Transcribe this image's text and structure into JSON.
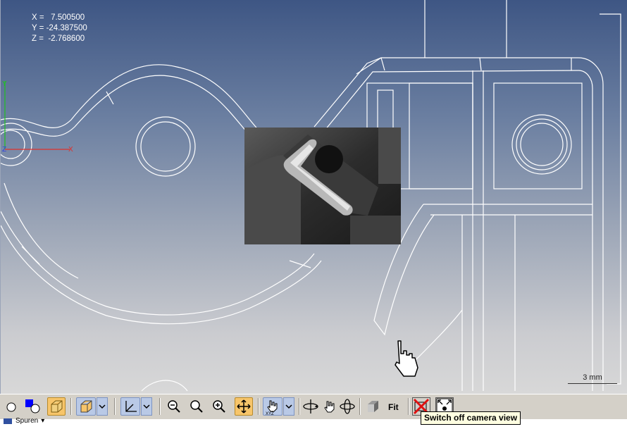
{
  "coords": {
    "x": "X =   7.500500",
    "y": "Y = -24.387500",
    "z": "Z =  -2.768600"
  },
  "axis_labels": {
    "x": "X",
    "y": "Y",
    "z": "Z"
  },
  "scale": {
    "label": "3 mm"
  },
  "toolbar": {
    "fit_label": "Fit",
    "buttons": [
      "point-toggle",
      "color-swatch",
      "3d-box-view",
      "view-cube",
      "coordinate-axes",
      "zoom-out",
      "zoom-window",
      "zoom-in",
      "pan-move",
      "pan-xyz",
      "rotate",
      "pan-hand",
      "rotate-3d",
      "shaded-cube",
      "fit",
      "camera-off",
      "fullscreen"
    ]
  },
  "tooltip": {
    "text": "Switch off camera view"
  },
  "status": {
    "item": "Spuren"
  },
  "colors": {
    "active_button": "#f7c56a",
    "group_button": "#b9c9e6",
    "tooltip_bg": "#ffffe1"
  }
}
